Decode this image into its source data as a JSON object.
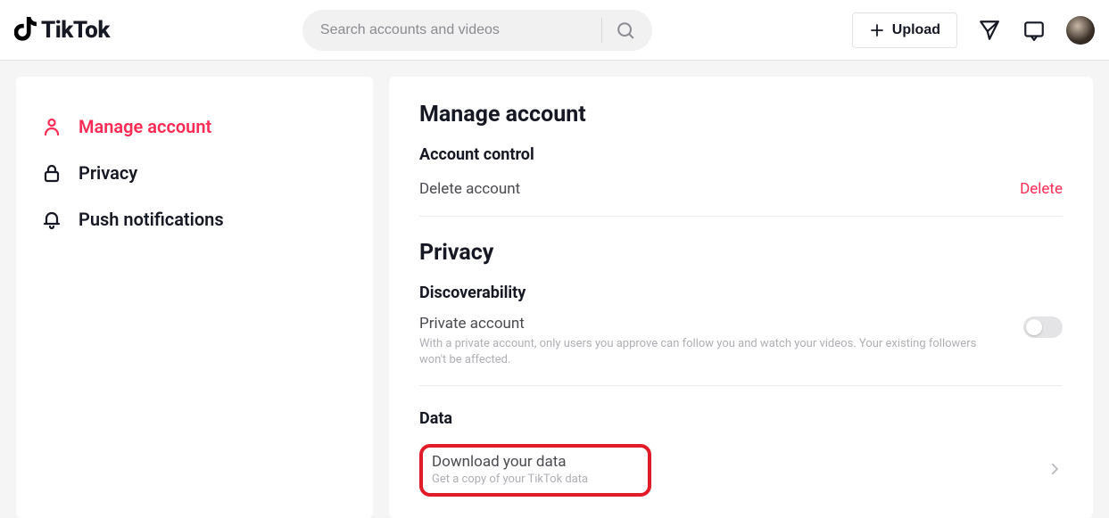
{
  "header": {
    "brand": "TikTok",
    "search_placeholder": "Search accounts and videos",
    "upload_label": "Upload"
  },
  "sidebar": {
    "items": [
      {
        "label": "Manage account"
      },
      {
        "label": "Privacy"
      },
      {
        "label": "Push notifications"
      }
    ]
  },
  "main": {
    "manage_title": "Manage account",
    "account_control_title": "Account control",
    "delete_account_label": "Delete account",
    "delete_action": "Delete",
    "privacy_title": "Privacy",
    "discoverability_title": "Discoverability",
    "private_account_label": "Private account",
    "private_account_desc": "With a private account, only users you approve can follow you and watch your videos. Your existing followers won't be affected.",
    "data_title": "Data",
    "download_label": "Download your data",
    "download_sub": "Get a copy of your TikTok data"
  }
}
